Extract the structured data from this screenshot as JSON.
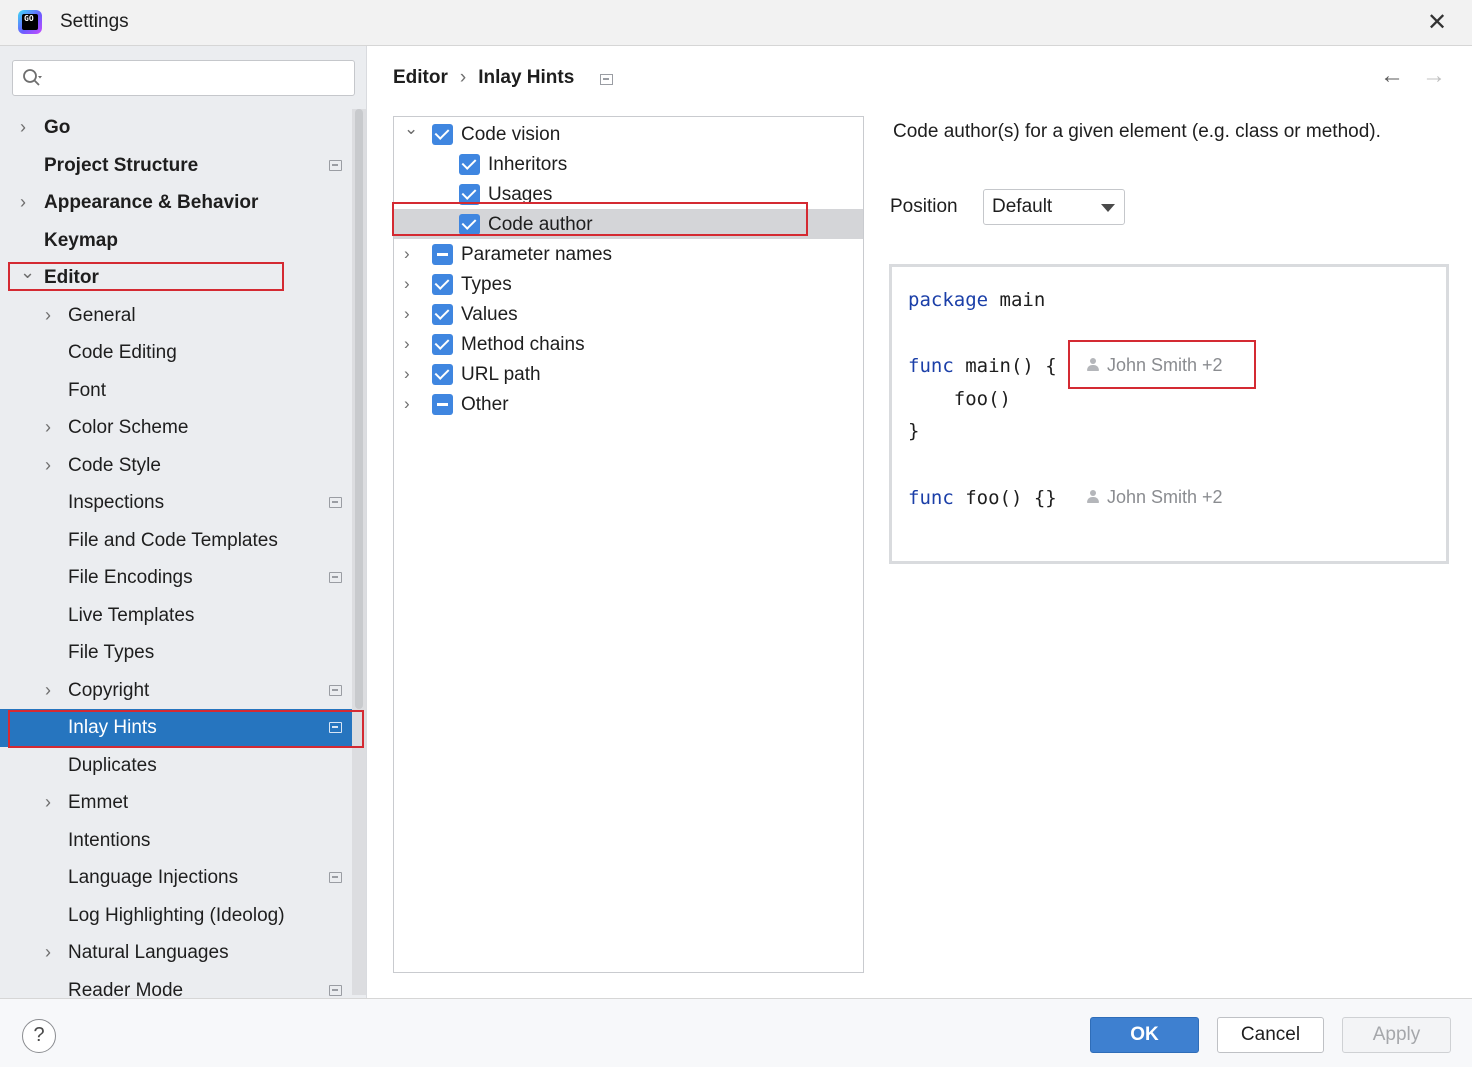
{
  "window": {
    "title": "Settings"
  },
  "search": {
    "value": "",
    "placeholder": ""
  },
  "sidebar": {
    "items": [
      {
        "label": "Go",
        "level": 0,
        "chevron": "right",
        "badge": false
      },
      {
        "label": "Project Structure",
        "level": 0,
        "chevron": "none",
        "badge": true
      },
      {
        "label": "Appearance & Behavior",
        "level": 0,
        "chevron": "right",
        "badge": false
      },
      {
        "label": "Keymap",
        "level": 0,
        "chevron": "none",
        "badge": false
      },
      {
        "label": "Editor",
        "level": 0,
        "chevron": "down",
        "badge": false
      },
      {
        "label": "General",
        "level": 1,
        "chevron": "right",
        "badge": false
      },
      {
        "label": "Code Editing",
        "level": 1,
        "chevron": "none",
        "badge": false
      },
      {
        "label": "Font",
        "level": 1,
        "chevron": "none",
        "badge": false
      },
      {
        "label": "Color Scheme",
        "level": 1,
        "chevron": "right",
        "badge": false
      },
      {
        "label": "Code Style",
        "level": 1,
        "chevron": "right",
        "badge": false
      },
      {
        "label": "Inspections",
        "level": 1,
        "chevron": "none",
        "badge": true
      },
      {
        "label": "File and Code Templates",
        "level": 1,
        "chevron": "none",
        "badge": false
      },
      {
        "label": "File Encodings",
        "level": 1,
        "chevron": "none",
        "badge": true
      },
      {
        "label": "Live Templates",
        "level": 1,
        "chevron": "none",
        "badge": false
      },
      {
        "label": "File Types",
        "level": 1,
        "chevron": "none",
        "badge": false
      },
      {
        "label": "Copyright",
        "level": 1,
        "chevron": "right",
        "badge": true
      },
      {
        "label": "Inlay Hints",
        "level": 1,
        "chevron": "none",
        "badge": true,
        "selected": true
      },
      {
        "label": "Duplicates",
        "level": 1,
        "chevron": "none",
        "badge": false
      },
      {
        "label": "Emmet",
        "level": 1,
        "chevron": "right",
        "badge": false
      },
      {
        "label": "Intentions",
        "level": 1,
        "chevron": "none",
        "badge": false
      },
      {
        "label": "Language Injections",
        "level": 1,
        "chevron": "none",
        "badge": true
      },
      {
        "label": "Log Highlighting (Ideolog)",
        "level": 1,
        "chevron": "none",
        "badge": false
      },
      {
        "label": "Natural Languages",
        "level": 1,
        "chevron": "right",
        "badge": false
      },
      {
        "label": "Reader Mode",
        "level": 1,
        "chevron": "none",
        "badge": true
      }
    ]
  },
  "breadcrumb": {
    "parent": "Editor",
    "current": "Inlay Hints"
  },
  "hints_tree": [
    {
      "label": "Code vision",
      "level": 0,
      "chevron": "down",
      "state": "checked"
    },
    {
      "label": "Inheritors",
      "level": 1,
      "chevron": "none",
      "state": "checked"
    },
    {
      "label": "Usages",
      "level": 1,
      "chevron": "none",
      "state": "checked"
    },
    {
      "label": "Code author",
      "level": 1,
      "chevron": "none",
      "state": "checked",
      "selected": true
    },
    {
      "label": "Parameter names",
      "level": 0,
      "chevron": "right",
      "state": "partial"
    },
    {
      "label": "Types",
      "level": 0,
      "chevron": "right",
      "state": "checked"
    },
    {
      "label": "Values",
      "level": 0,
      "chevron": "right",
      "state": "checked"
    },
    {
      "label": "Method chains",
      "level": 0,
      "chevron": "right",
      "state": "checked"
    },
    {
      "label": "URL path",
      "level": 0,
      "chevron": "right",
      "state": "checked"
    },
    {
      "label": "Other",
      "level": 0,
      "chevron": "right",
      "state": "partial"
    }
  ],
  "detail": {
    "description": "Code author(s) for a given element (e.g. class or method).",
    "position_label": "Position",
    "position_value": "Default"
  },
  "preview": {
    "line1_kw": "package",
    "line1_rest": " main",
    "line2_kw": "func",
    "line2_rest": " main() {",
    "line2_hint": "John Smith +2",
    "line3": "    foo()",
    "line4": "}",
    "line5_kw": "func",
    "line5_rest": " foo() {}",
    "line5_hint": "John Smith +2"
  },
  "buttons": {
    "help": "?",
    "ok": "OK",
    "cancel": "Cancel",
    "apply": "Apply"
  },
  "colors": {
    "accent": "#3e80d0",
    "selection": "#2675bf",
    "highlight_box": "#d42a32",
    "keyword": "#1b3fa8"
  }
}
